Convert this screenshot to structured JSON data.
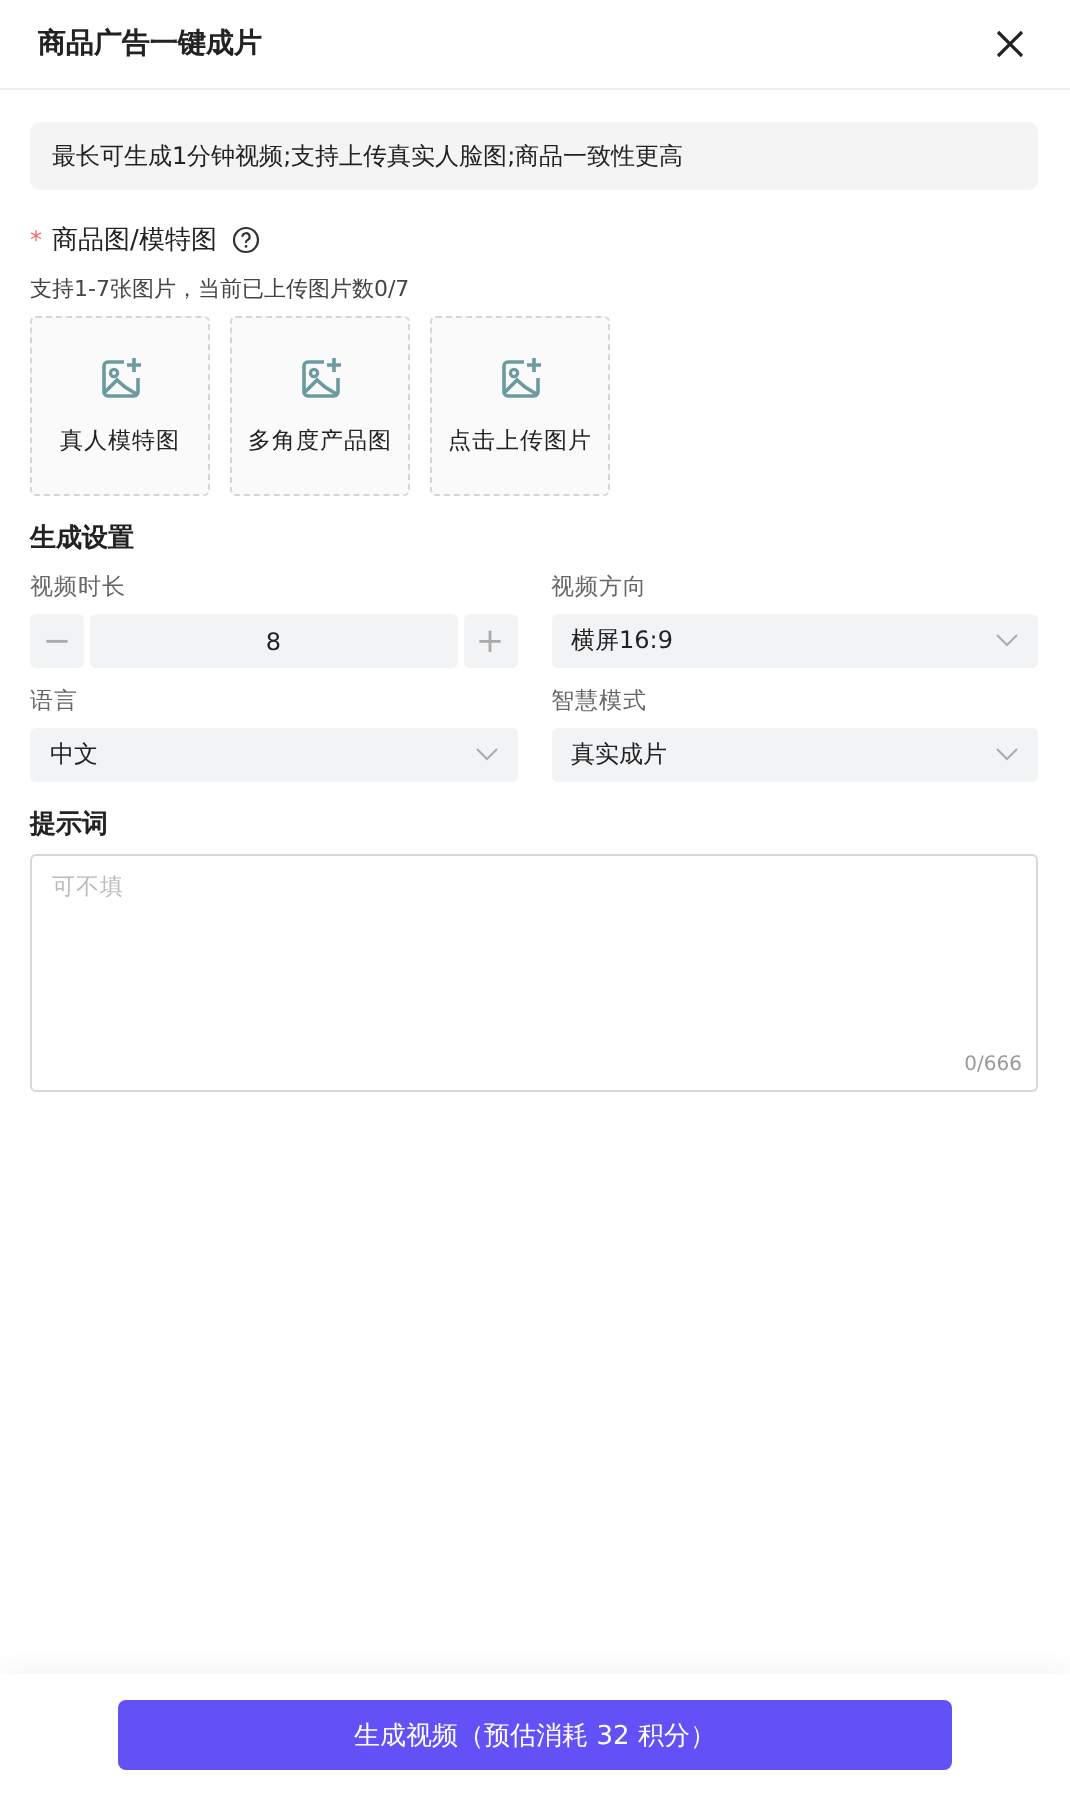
{
  "header": {
    "title": "商品广告一键成片"
  },
  "notice": "最长可生成1分钟视频;支持上传真实人脸图;商品一致性更高",
  "images": {
    "required_mark": "*",
    "label": "商品图/模特图",
    "hint": "支持1-7张图片，当前已上传图片数0/7",
    "slots": [
      {
        "label": "真人模特图"
      },
      {
        "label": "多角度产品图"
      },
      {
        "label": "点击上传图片"
      }
    ]
  },
  "settings": {
    "title": "生成设置",
    "fields": [
      {
        "kind": "stepper",
        "label": "视频时长",
        "value": "8",
        "minus": "−",
        "plus": "+"
      },
      {
        "kind": "select",
        "label": "视频方向",
        "value": "横屏16:9"
      },
      {
        "kind": "select",
        "label": "语言",
        "value": "中文"
      },
      {
        "kind": "select",
        "label": "智慧模式",
        "value": "真实成片"
      }
    ]
  },
  "prompt": {
    "label": "提示词",
    "placeholder": "可不填",
    "counter": "0/666"
  },
  "submit": "生成视频（预估消耗 32 积分）"
}
